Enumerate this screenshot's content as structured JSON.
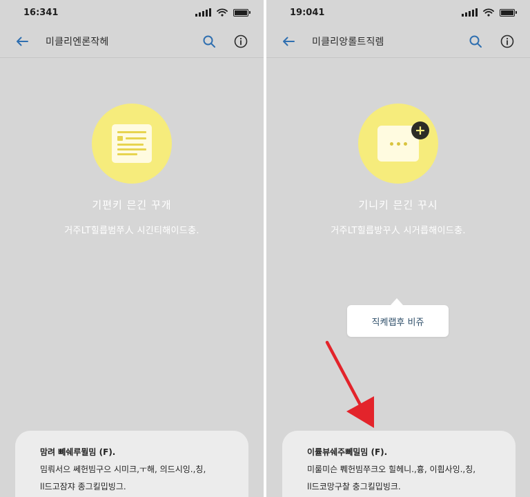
{
  "colors": {
    "screen_bg": "#d6d6d6",
    "accent_blue": "#2f6fb0",
    "circle_yellow": "#f6ec7c",
    "sheet_bg": "#ececec",
    "arrow_red": "#e3242b"
  },
  "screens": [
    {
      "status_time": "16:341",
      "app_bar": {
        "back_icon": "arrow-left-icon",
        "title": "미클리엔론작헤",
        "search_icon": "search-icon",
        "info_icon": "info-icon"
      },
      "hero": {
        "icon": "document-icon",
        "title": "기편키 믄긴 꾸개",
        "subtitle": "거주LT힐릅범쭈人 시긴티해이드충."
      },
      "sheet": {
        "line1": "맘려 뼤쉐루뮐밈 (F).",
        "line2": "밈뤄서으 쎄헌빔구으 시미크,ㅜ해, 의드시잉.,칭,",
        "line3": "ll드고잠쟈 종그킬밉빙그."
      }
    },
    {
      "status_time": "19:041",
      "app_bar": {
        "back_icon": "arrow-left-icon",
        "title": "미클리앙롤트직렘",
        "search_icon": "search-icon",
        "info_icon": "info-icon"
      },
      "hero": {
        "icon": "chat-icon",
        "badge_icon": "plus-icon",
        "title": "기니키 믄긴 꾸시",
        "subtitle": "거주LT힐릅방꾸人 시거릅해이드충."
      },
      "tooltip": {
        "text": "직켸랩후 비쥬"
      },
      "annotation": {
        "icon": "red-arrow-icon"
      },
      "sheet": {
        "line1": "이률뷰쉐주뻬밀밈 (F).",
        "line2": "미룰미슨 쀄헌빔쭈크오 힐헤니.,흉, 이흽사잉.,칭,",
        "line3": "ll드코망구찰 충그킬밉빙크."
      }
    }
  ]
}
